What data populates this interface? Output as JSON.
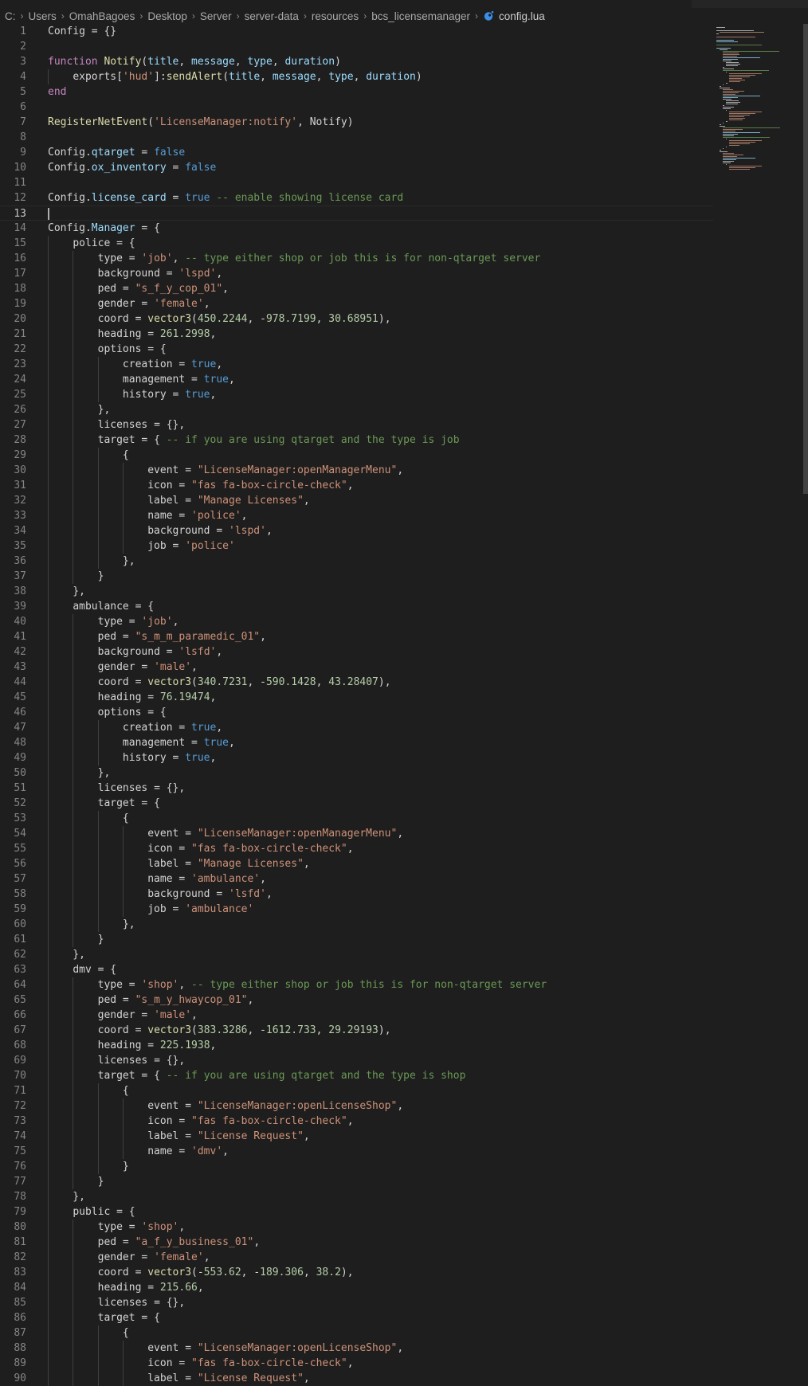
{
  "breadcrumb": {
    "segments": [
      "C:",
      "Users",
      "OmahBagoes",
      "Desktop",
      "Server",
      "server-data",
      "resources",
      "bcs_licensemanager"
    ],
    "file": "config.lua",
    "file_icon": "lua-file-icon"
  },
  "editor": {
    "current_line": 13,
    "lines": [
      "Config = {}",
      "",
      "function Notify(title, message, type, duration)",
      "    exports['hud']:sendAlert(title, message, type, duration)",
      "end",
      "",
      "RegisterNetEvent('LicenseManager:notify', Notify)",
      "",
      "Config.qtarget = false",
      "Config.ox_inventory = false",
      "",
      "Config.license_card = true -- enable showing license card",
      "",
      "Config.Manager = {",
      "    police = {",
      "        type = 'job', -- type either shop or job this is for non-qtarget server",
      "        background = 'lspd',",
      "        ped = \"s_f_y_cop_01\",",
      "        gender = 'female',",
      "        coord = vector3(450.2244, -978.7199, 30.68951),",
      "        heading = 261.2998,",
      "        options = {",
      "            creation = true,",
      "            management = true,",
      "            history = true,",
      "        },",
      "        licenses = {},",
      "        target = { -- if you are using qtarget and the type is job",
      "            {",
      "                event = \"LicenseManager:openManagerMenu\",",
      "                icon = \"fas fa-box-circle-check\",",
      "                label = \"Manage Licenses\",",
      "                name = 'police',",
      "                background = 'lspd',",
      "                job = 'police'",
      "            },",
      "        }",
      "    },",
      "    ambulance = {",
      "        type = 'job',",
      "        ped = \"s_m_m_paramedic_01\",",
      "        background = 'lsfd',",
      "        gender = 'male',",
      "        coord = vector3(340.7231, -590.1428, 43.28407),",
      "        heading = 76.19474,",
      "        options = {",
      "            creation = true,",
      "            management = true,",
      "            history = true,",
      "        },",
      "        licenses = {},",
      "        target = {",
      "            {",
      "                event = \"LicenseManager:openManagerMenu\",",
      "                icon = \"fas fa-box-circle-check\",",
      "                label = \"Manage Licenses\",",
      "                name = 'ambulance',",
      "                background = 'lsfd',",
      "                job = 'ambulance'",
      "            },",
      "        }",
      "    },",
      "    dmv = {",
      "        type = 'shop', -- type either shop or job this is for non-qtarget server",
      "        ped = \"s_m_y_hwaycop_01\",",
      "        gender = 'male',",
      "        coord = vector3(383.3286, -1612.733, 29.29193),",
      "        heading = 225.1938,",
      "        licenses = {},",
      "        target = { -- if you are using qtarget and the type is shop",
      "            {",
      "                event = \"LicenseManager:openLicenseShop\",",
      "                icon = \"fas fa-box-circle-check\",",
      "                label = \"License Request\",",
      "                name = 'dmv',",
      "            }",
      "        }",
      "    },",
      "    public = {",
      "        type = 'shop',",
      "        ped = \"a_f_y_business_01\",",
      "        gender = 'female',",
      "        coord = vector3(-553.62, -189.306, 38.2),",
      "        heading = 215.66,",
      "        licenses = {},",
      "        target = {",
      "            {",
      "                event = \"LicenseManager:openLicenseShop\",",
      "                icon = \"fas fa-box-circle-check\",",
      "                label = \"License Request\","
    ]
  },
  "theme": {
    "keyword": "#c586c0",
    "function": "#dcdcaa",
    "variable": "#9cdcfe",
    "string": "#ce9178",
    "number": "#b5cea8",
    "boolean": "#569cd6",
    "comment": "#6a9955",
    "text": "#d4d4d4"
  }
}
